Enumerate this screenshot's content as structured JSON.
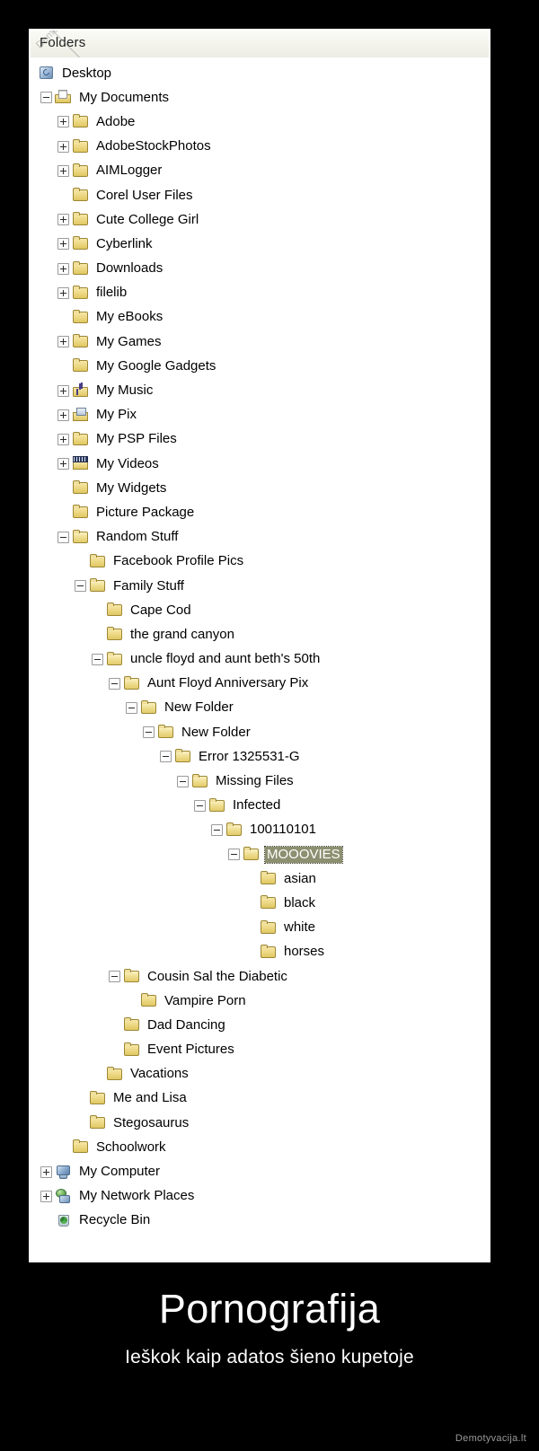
{
  "window": {
    "header_label": "Folders",
    "corner_watermark": "Demotyvacija.lt"
  },
  "selection_color": "#8c9070",
  "tree": {
    "items": [
      {
        "label": "Desktop",
        "depth": 0,
        "icon": "desktop-icon",
        "twisty": "none"
      },
      {
        "label": "My Documents",
        "depth": 1,
        "icon": "documents-icon",
        "twisty": "minus"
      },
      {
        "label": "Adobe",
        "depth": 2,
        "icon": "folder-icon",
        "twisty": "plus"
      },
      {
        "label": "AdobeStockPhotos",
        "depth": 2,
        "icon": "folder-icon",
        "twisty": "plus"
      },
      {
        "label": "AIMLogger",
        "depth": 2,
        "icon": "folder-icon",
        "twisty": "plus"
      },
      {
        "label": "Corel User Files",
        "depth": 2,
        "icon": "folder-icon",
        "twisty": "none"
      },
      {
        "label": "Cute College Girl",
        "depth": 2,
        "icon": "folder-icon",
        "twisty": "plus"
      },
      {
        "label": "Cyberlink",
        "depth": 2,
        "icon": "folder-icon",
        "twisty": "plus"
      },
      {
        "label": "Downloads",
        "depth": 2,
        "icon": "folder-icon",
        "twisty": "plus"
      },
      {
        "label": "filelib",
        "depth": 2,
        "icon": "folder-icon",
        "twisty": "plus"
      },
      {
        "label": "My eBooks",
        "depth": 2,
        "icon": "folder-icon",
        "twisty": "none"
      },
      {
        "label": "My Games",
        "depth": 2,
        "icon": "folder-icon",
        "twisty": "plus"
      },
      {
        "label": "My Google Gadgets",
        "depth": 2,
        "icon": "folder-icon",
        "twisty": "none"
      },
      {
        "label": "My Music",
        "depth": 2,
        "icon": "music-folder-icon",
        "twisty": "plus"
      },
      {
        "label": "My Pix",
        "depth": 2,
        "icon": "picture-folder-icon",
        "twisty": "plus"
      },
      {
        "label": "My PSP Files",
        "depth": 2,
        "icon": "folder-icon",
        "twisty": "plus"
      },
      {
        "label": "My Videos",
        "depth": 2,
        "icon": "video-folder-icon",
        "twisty": "plus"
      },
      {
        "label": "My Widgets",
        "depth": 2,
        "icon": "folder-icon",
        "twisty": "none"
      },
      {
        "label": "Picture Package",
        "depth": 2,
        "icon": "folder-icon",
        "twisty": "none"
      },
      {
        "label": "Random Stuff",
        "depth": 2,
        "icon": "folder-open-icon",
        "twisty": "minus"
      },
      {
        "label": "Facebook Profile Pics",
        "depth": 3,
        "icon": "folder-icon",
        "twisty": "none"
      },
      {
        "label": "Family Stuff",
        "depth": 3,
        "icon": "folder-open-icon",
        "twisty": "minus"
      },
      {
        "label": "Cape Cod",
        "depth": 4,
        "icon": "folder-icon",
        "twisty": "none"
      },
      {
        "label": "the grand canyon",
        "depth": 4,
        "icon": "folder-icon",
        "twisty": "none"
      },
      {
        "label": "uncle floyd and aunt beth's 50th",
        "depth": 4,
        "icon": "folder-open-icon",
        "twisty": "minus"
      },
      {
        "label": "Aunt Floyd Anniversary Pix",
        "depth": 5,
        "icon": "folder-open-icon",
        "twisty": "minus"
      },
      {
        "label": "New Folder",
        "depth": 6,
        "icon": "folder-open-icon",
        "twisty": "minus"
      },
      {
        "label": "New Folder",
        "depth": 7,
        "icon": "folder-open-icon",
        "twisty": "minus"
      },
      {
        "label": "Error 1325531-G",
        "depth": 8,
        "icon": "folder-open-icon",
        "twisty": "minus"
      },
      {
        "label": "Missing Files",
        "depth": 9,
        "icon": "folder-open-icon",
        "twisty": "minus"
      },
      {
        "label": "Infected",
        "depth": 10,
        "icon": "folder-open-icon",
        "twisty": "minus"
      },
      {
        "label": "100110101",
        "depth": 11,
        "icon": "folder-open-icon",
        "twisty": "minus"
      },
      {
        "label": "MOOOVIES",
        "depth": 12,
        "icon": "folder-open-icon",
        "twisty": "minus",
        "selected": true
      },
      {
        "label": "asian",
        "depth": 13,
        "icon": "folder-icon",
        "twisty": "none"
      },
      {
        "label": "black",
        "depth": 13,
        "icon": "folder-icon",
        "twisty": "none"
      },
      {
        "label": "white",
        "depth": 13,
        "icon": "folder-icon",
        "twisty": "none"
      },
      {
        "label": "horses",
        "depth": 13,
        "icon": "folder-icon",
        "twisty": "none"
      },
      {
        "label": "Cousin Sal the Diabetic",
        "depth": 5,
        "icon": "folder-open-icon",
        "twisty": "minus"
      },
      {
        "label": "Vampire Porn",
        "depth": 6,
        "icon": "folder-icon",
        "twisty": "none"
      },
      {
        "label": "Dad Dancing",
        "depth": 5,
        "icon": "folder-icon",
        "twisty": "none"
      },
      {
        "label": "Event Pictures",
        "depth": 5,
        "icon": "folder-icon",
        "twisty": "none"
      },
      {
        "label": "Vacations",
        "depth": 4,
        "icon": "folder-icon",
        "twisty": "none"
      },
      {
        "label": "Me and Lisa",
        "depth": 3,
        "icon": "folder-icon",
        "twisty": "none"
      },
      {
        "label": "Stegosaurus",
        "depth": 3,
        "icon": "folder-icon",
        "twisty": "none"
      },
      {
        "label": "Schoolwork",
        "depth": 2,
        "icon": "folder-icon",
        "twisty": "none"
      },
      {
        "label": "My Computer",
        "depth": 1,
        "icon": "computer-icon",
        "twisty": "plus"
      },
      {
        "label": "My Network Places",
        "depth": 1,
        "icon": "network-icon",
        "twisty": "plus"
      },
      {
        "label": "Recycle Bin",
        "depth": 1,
        "icon": "recycle-bin-icon",
        "twisty": "none"
      }
    ]
  },
  "caption": {
    "title": "Pornografija",
    "subtitle": "Ieškok kaip adatos šieno kupetoje"
  },
  "watermark": "Demotyvacija.lt"
}
